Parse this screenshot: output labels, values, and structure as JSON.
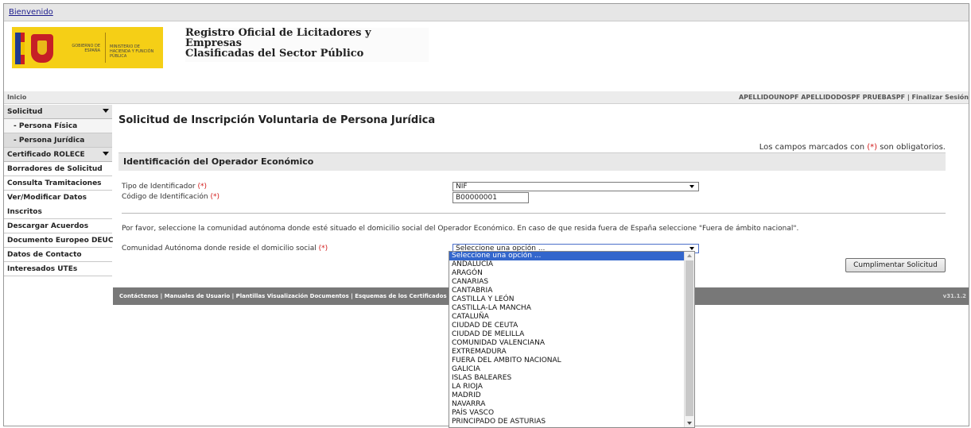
{
  "topbar": {
    "link": "Bienvenido"
  },
  "header": {
    "logo_gobierno": "GOBIERNO DE ESPAÑA",
    "logo_ministerio": "MINISTERIO DE HACIENDA Y FUNCIÓN PÚBLICA",
    "title_line1": "Registro Oficial de Licitadores y Empresas",
    "title_line2": "Clasificadas del Sector Público"
  },
  "navbar": {
    "inicio": "Inicio",
    "user": "APELLIDOUNOPF APELLIDODOSPF PRUEBASPF",
    "separator": " | ",
    "logout": "Finalizar Sesión"
  },
  "sidebar": {
    "solicitud": "Solicitud",
    "persona_fisica": "- Persona Física",
    "persona_juridica": "- Persona Jurídica",
    "certificado": "Certificado ROLECE",
    "borradores": "Borradores de Solicitud",
    "consulta": "Consulta Tramitaciones",
    "ver_modificar_1": "Ver/Modificar Datos",
    "ver_modificar_2": "Inscritos",
    "descargar": "Descargar Acuerdos",
    "deuc": "Documento Europeo DEUC",
    "contacto": "Datos de Contacto",
    "utes": "Interesados UTEs"
  },
  "main": {
    "page_title": "Solicitud de Inscripción Voluntaria de Persona Jurídica",
    "req_prefix": "Los campos marcados con ",
    "req_mark": "(*)",
    "req_suffix": " son obligatorios.",
    "section_title": "Identificación del Operador Económico",
    "tipo_label": "Tipo de Identificador ",
    "tipo_value": "NIF",
    "codigo_label": "Código de Identificación ",
    "codigo_value": "B00000001",
    "info_text": "Por favor, seleccione la comunidad autónoma donde esté situado el domicilio social del Operador Económico. En caso de que resida fuera de España seleccione \"Fuera de ámbito nacional\".",
    "comunidad_label": "Comunidad Autónoma donde reside el domicilio social ",
    "comunidad_value": "Seleccione una opción ...",
    "button": "Cumplimentar Solicitud"
  },
  "footer": {
    "links": "Contáctenos | Manuales de Usuario | Plantillas Visualización Documentos | Esquemas de los Certificados",
    "version": "v31.1.2"
  },
  "dropdown_options": [
    "Seleccione una opción ...",
    "ANDALUCÍA",
    "ARAGÓN",
    "CANARIAS",
    "CANTABRIA",
    "CASTILLA Y LEÓN",
    "CASTILLA-LA MANCHA",
    "CATALUÑA",
    "CIUDAD DE CEUTA",
    "CIUDAD DE MELILLA",
    "COMUNIDAD VALENCIANA",
    "EXTREMADURA",
    "FUERA DEL AMBITO NACIONAL",
    "GALICIA",
    "ISLAS BALEARES",
    "LA RIOJA",
    "MADRID",
    "NAVARRA",
    "PAÍS VASCO",
    "PRINCIPADO DE ASTURIAS"
  ],
  "colors": {
    "required": "#d21a1a",
    "selected_option": "#3366cc",
    "logo_bg": "#f5cf16",
    "footer_bg": "#787878"
  }
}
